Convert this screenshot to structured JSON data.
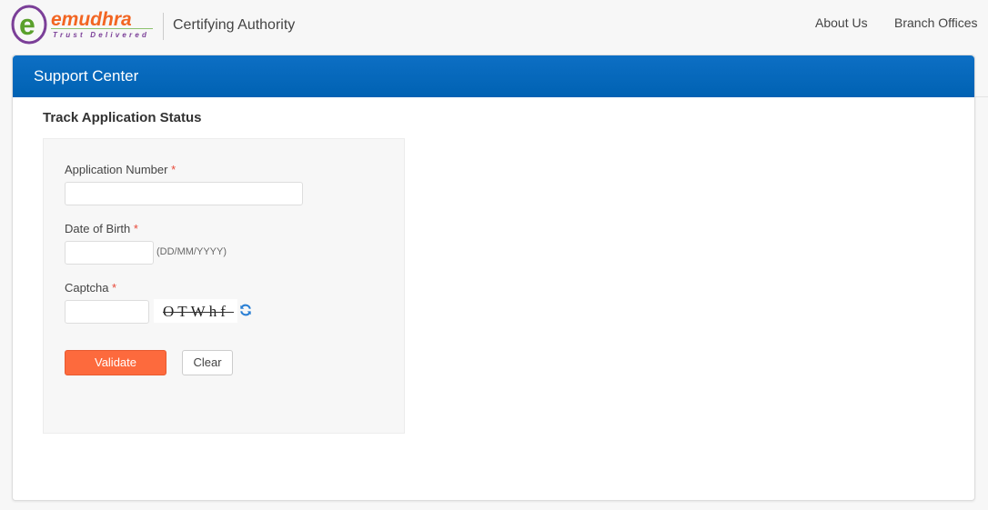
{
  "header": {
    "logo": {
      "brand": "emudhra",
      "tagline": "Trust Delivered",
      "letter": "e",
      "colors": {
        "brand": "#f26522",
        "ring": "#7b3f98",
        "letter": "#5aa02c"
      }
    },
    "subtitle": "Certifying Authority",
    "nav": [
      {
        "label": "About Us"
      },
      {
        "label": "Branch Offices"
      }
    ]
  },
  "panel": {
    "title": "Support Center",
    "header_color": "#0066b8"
  },
  "form": {
    "title": "Track Application Status",
    "fields": {
      "application_number": {
        "label": "Application Number",
        "required_mark": "*",
        "value": "",
        "placeholder": ""
      },
      "date_of_birth": {
        "label": "Date of Birth",
        "required_mark": "*",
        "value": "",
        "placeholder": "",
        "hint": "(DD/MM/YYYY)"
      },
      "captcha": {
        "label": "Captcha",
        "required_mark": "*",
        "value": "",
        "placeholder": "",
        "image_text": "OTWhf",
        "refresh_icon": "refresh-icon"
      }
    },
    "buttons": {
      "validate": {
        "label": "Validate",
        "color": "#fd6a3d"
      },
      "clear": {
        "label": "Clear"
      }
    }
  }
}
